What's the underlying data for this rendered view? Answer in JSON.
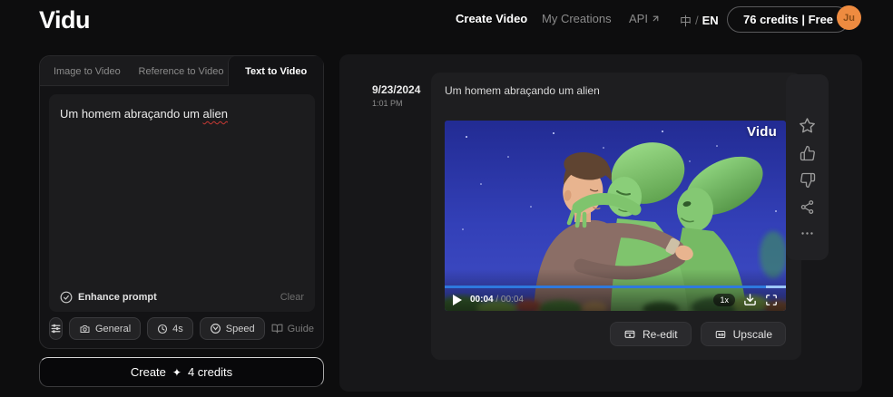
{
  "icons": {
    "sparkle": "✦"
  },
  "navbar": {
    "logo": "Vidu",
    "create_video": "Create Video",
    "my_creations": "My Creations",
    "api": "API",
    "lang_zh": "中",
    "lang_separator": "/",
    "lang_en": "EN",
    "credits_button": "76 credits | Free",
    "avatar_initials": "Ju"
  },
  "left_panel": {
    "tabs": [
      {
        "label": "Image to Video"
      },
      {
        "label": "Reference to Video"
      },
      {
        "label": "Text to Video"
      }
    ],
    "prompt_text": "Um homem abraçando um ",
    "prompt_flagged_word": "alien",
    "enhance_prompt_label": "Enhance prompt",
    "clear_label": "Clear",
    "options": {
      "general": "General",
      "duration": "4s",
      "speed": "Speed",
      "guide": "Guide"
    },
    "create_label": "Create",
    "create_cost": "4 credits"
  },
  "creation": {
    "date": "9/23/2024",
    "time": "1:01 PM",
    "title": "Um homem abraçando um alien",
    "video": {
      "watermark": "Vidu",
      "current_time": "00:04",
      "time_separator": "/",
      "total_time": "00:04",
      "speed": "1x"
    },
    "re_edit_label": "Re-edit",
    "upscale_label": "Upscale"
  },
  "colors": {
    "accent_blue": "#2e79de",
    "avatar_orange": "#ee8b40",
    "spellcheck_red": "#c93a34"
  }
}
